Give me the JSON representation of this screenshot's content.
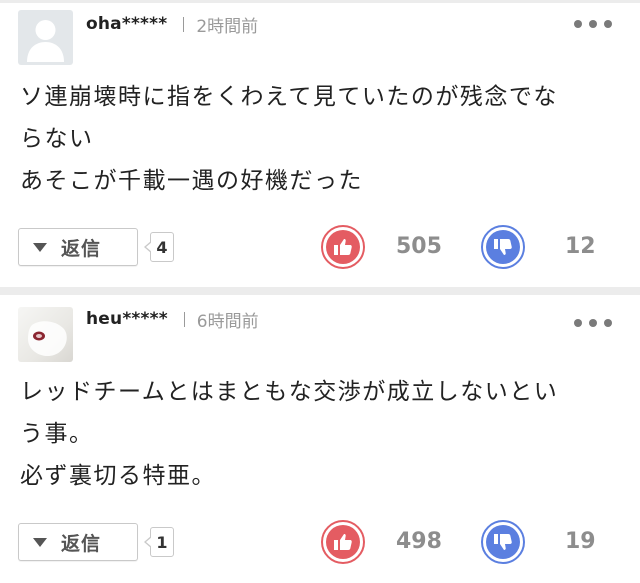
{
  "comments": [
    {
      "username": "oha*****",
      "time": "2時間前",
      "avatar": "default-avatar",
      "lines": [
        "ソ連崩壊時に指をくわえて見ていたのが残念でな",
        "らない",
        "あそこが千載一遇の好機だった"
      ],
      "reply_label": "返信",
      "reply_count": "4",
      "likes": "505",
      "dislikes": "12"
    },
    {
      "username": "heu*****",
      "time": "6時間前",
      "avatar": "photo-avatar",
      "lines": [
        "レッドチームとはまともな交渉が成立しないとい",
        "う事。",
        "必ず裏切る特亜。"
      ],
      "reply_label": "返信",
      "reply_count": "1",
      "likes": "498",
      "dislikes": "19"
    }
  ],
  "colors": {
    "like": "#e45c62",
    "dislike": "#5b7fe0",
    "separator": "#ececec"
  },
  "icons": [
    "more-icon",
    "chevron-down-icon",
    "thumbs-up-icon",
    "thumbs-down-icon",
    "avatar-placeholder-icon"
  ]
}
